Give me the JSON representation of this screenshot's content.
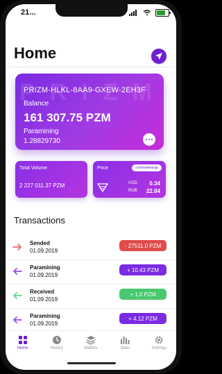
{
  "status": {
    "time": "21..."
  },
  "header": {
    "title": "Home"
  },
  "wallet": {
    "watermark": "P R I Z M",
    "address": "PRIZM-HLKL-8AA9-GXEW-2EH3F",
    "balance_label": "Balance",
    "balance_value": "161 307.75 PZM",
    "paramining_label": "Paramining",
    "paramining_value": "1.28829730"
  },
  "total_volume": {
    "label": "Total Volume",
    "value": "2 227 011.37 PZM"
  },
  "price": {
    "label": "Price",
    "badge": "coinmarketcap",
    "usd_label": "USD",
    "usd_value": "0.34",
    "rub_label": "RUB",
    "rub_value": "22.84"
  },
  "transactions": {
    "title": "Transactions",
    "items": [
      {
        "type": "Sended",
        "date": "01.09.2019",
        "amount": "- 27511.0 PZM",
        "color": "#e04b4b",
        "icon": "arrow-right-icon"
      },
      {
        "type": "Paramining",
        "date": "01.09.2019",
        "amount": "+ 10.43 PZM",
        "color": "#7a2be3",
        "icon": "arrow-left-icon"
      },
      {
        "type": "Received",
        "date": "01.09.2019",
        "amount": "+ 1.0 PZM",
        "color": "#49c96f",
        "icon": "arrow-left-icon"
      },
      {
        "type": "Paramining",
        "date": "01.09.2019",
        "amount": "+ 4.12 PZM",
        "color": "#7a2be3",
        "icon": "arrow-left-icon"
      }
    ]
  },
  "tabs": [
    {
      "label": "Home",
      "active": true
    },
    {
      "label": "History"
    },
    {
      "label": "Wallets"
    },
    {
      "label": "Stats"
    },
    {
      "label": "Settings"
    }
  ],
  "colors": {
    "accent": "#6f1fd1",
    "green": "#49c96f",
    "red": "#e04b4b"
  }
}
